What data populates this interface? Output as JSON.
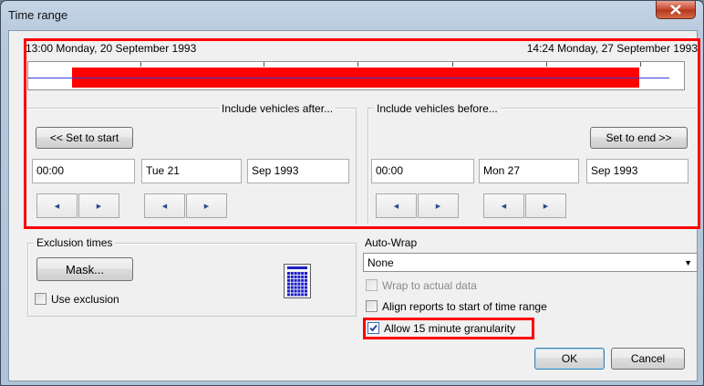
{
  "window": {
    "title": "Time range",
    "close_icon": "close-icon"
  },
  "range": {
    "start_label": "13:00 Monday, 20 September 1993",
    "end_label": "14:24 Monday, 27 September 1993"
  },
  "after": {
    "legend": "Include vehicles after...",
    "set_button": "<< Set to start",
    "time": "00:00",
    "day": "Tue 21",
    "month": "Sep 1993"
  },
  "before": {
    "legend": "Include vehicles before...",
    "set_button": "Set to end >>",
    "time": "00:00",
    "day": "Mon 27",
    "month": "Sep 1993"
  },
  "exclusion": {
    "legend": "Exclusion times",
    "mask_button": "Mask...",
    "use_exclusion": "Use exclusion",
    "use_exclusion_checked": false,
    "icon": "calendar-grid-icon"
  },
  "autowrap": {
    "label": "Auto-Wrap",
    "selected": "None",
    "wrap_actual": "Wrap to actual data",
    "align_reports": "Align reports to start of time range",
    "allow_15": "Allow 15 minute granularity",
    "allow_15_checked": true
  },
  "footer": {
    "ok": "OK",
    "cancel": "Cancel"
  },
  "colors": {
    "highlight": "#ff0000",
    "timeline_line": "#3b3bd6",
    "calendar_icon": "#1c1cc8"
  }
}
